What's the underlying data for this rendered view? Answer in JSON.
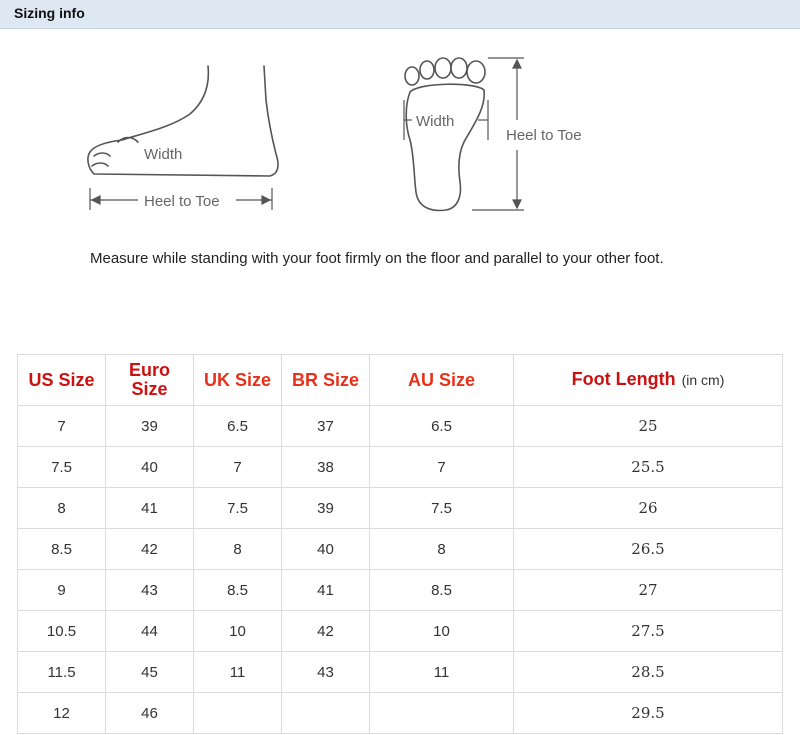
{
  "header": {
    "title": "Sizing info"
  },
  "figure": {
    "side_view": {
      "width_label": "Width",
      "length_label": "Heel to Toe"
    },
    "sole_view": {
      "width_label": "Width",
      "length_label": "Heel to Toe"
    },
    "caption": "Measure while standing with your foot firmly on the floor and parallel to your other foot."
  },
  "table": {
    "headers": {
      "us": "US Size",
      "euro_line1": "Euro",
      "euro_line2": "Size",
      "uk": "UK Size",
      "br": "BR Size",
      "au": "AU Size",
      "foot": "Foot Length",
      "unit": "(in cm)"
    },
    "rows": [
      {
        "us": "7",
        "euro": "39",
        "uk": "6.5",
        "br": "37",
        "au": "6.5",
        "foot": "25"
      },
      {
        "us": "7.5",
        "euro": "40",
        "uk": "7",
        "br": "38",
        "au": "7",
        "foot": "25.5"
      },
      {
        "us": "8",
        "euro": "41",
        "uk": "7.5",
        "br": "39",
        "au": "7.5",
        "foot": "26"
      },
      {
        "us": "8.5",
        "euro": "42",
        "uk": "8",
        "br": "40",
        "au": "8",
        "foot": "26.5"
      },
      {
        "us": "9",
        "euro": "43",
        "uk": "8.5",
        "br": "41",
        "au": "8.5",
        "foot": "27"
      },
      {
        "us": "10.5",
        "euro": "44",
        "uk": "10",
        "br": "42",
        "au": "10",
        "foot": "27.5"
      },
      {
        "us": "11.5",
        "euro": "45",
        "uk": "11",
        "br": "43",
        "au": "11",
        "foot": "28.5"
      },
      {
        "us": "12",
        "euro": "46",
        "uk": "",
        "br": "",
        "au": "",
        "foot": "29.5"
      }
    ]
  }
}
